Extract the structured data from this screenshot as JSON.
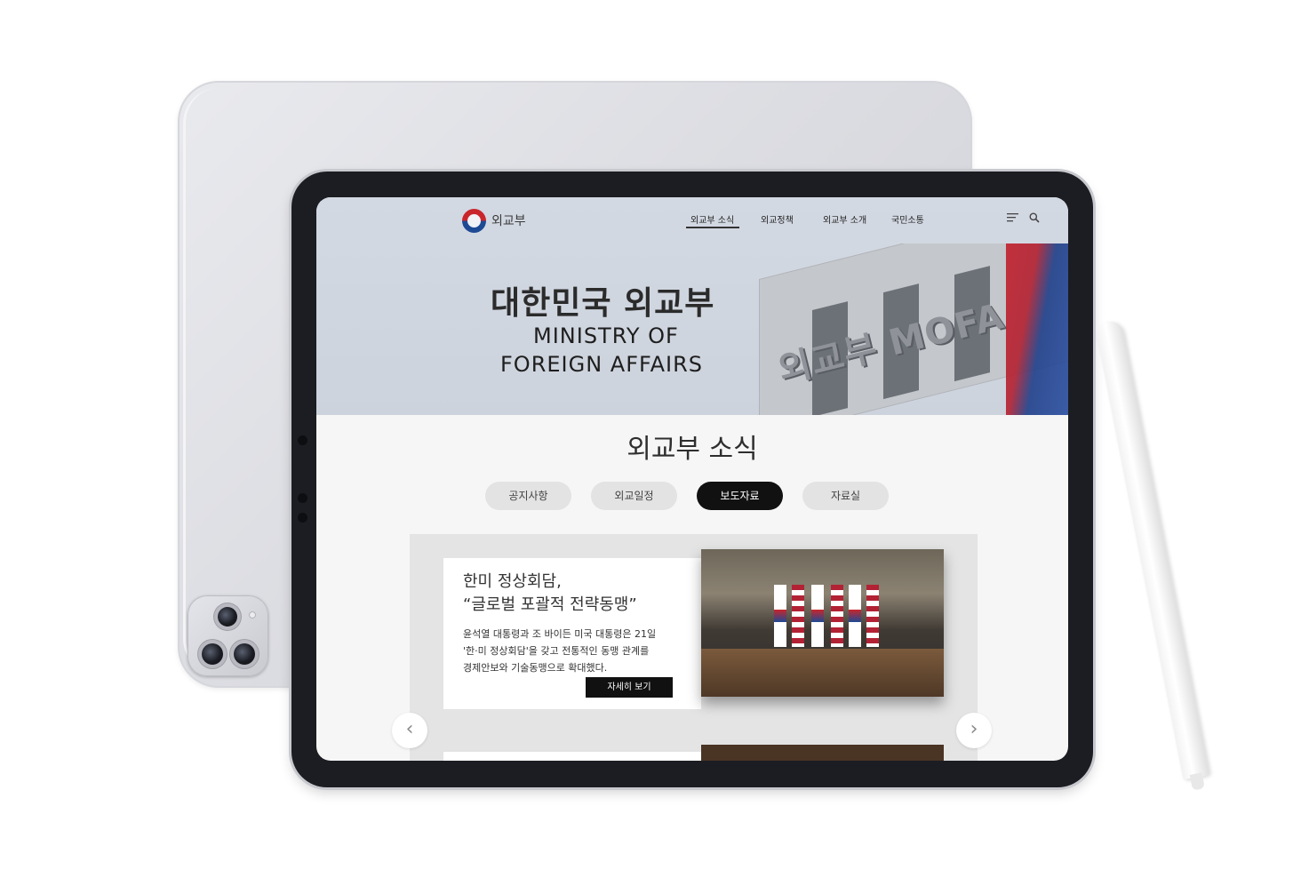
{
  "header": {
    "logo_text": "외교부",
    "nav": [
      "외교부 소식",
      "외교정책",
      "외교부 소개",
      "국민소통"
    ],
    "active_nav": "외교부 소식",
    "menu_icon": "menu-lines-icon",
    "search_icon": "search-icon"
  },
  "hero": {
    "title_ko": "대한민국 외교부",
    "title_en_line1": "MINISTRY OF",
    "title_en_line2": "FOREIGN AFFAIRS",
    "building_sign": "외교부 MOFA"
  },
  "section": {
    "title": "외교부 소식",
    "tabs": [
      "공지사항",
      "외교일정",
      "보도자료",
      "자료실"
    ],
    "active_tab": "보도자료"
  },
  "card": {
    "title_line1": "한미 정상회담,",
    "title_line2": "“글로벌 포괄적 전략동맹”",
    "body_line1": "윤석열 대통령과 조 바이든 미국 대통령은 21일",
    "body_line2": "'한·미 정상회담'을 갖고 전통적인 동맹 관계를",
    "body_line3": "경제안보와 기술동맹으로 확대했다.",
    "button": "자세히 보기"
  },
  "carousel": {
    "prev": "‹",
    "next": "›"
  },
  "colors": {
    "accent_dark": "#111111",
    "hero_bg": "#d3d9e3",
    "flag_red": "#c9262c",
    "flag_blue": "#1e4a94"
  }
}
